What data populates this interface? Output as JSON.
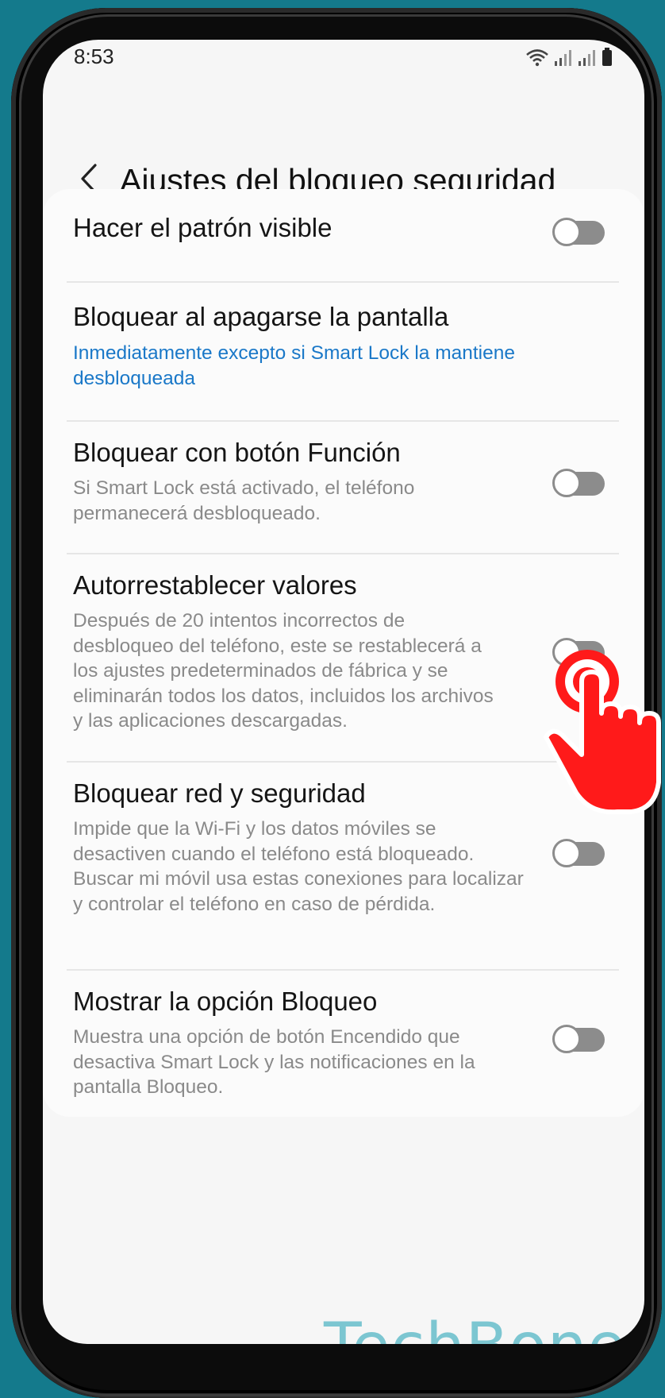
{
  "status": {
    "time": "8:53"
  },
  "header": {
    "title": "Ajustes del bloqueo seguridad"
  },
  "settings": [
    {
      "title": "Hacer el patrón visible",
      "subtitle": "",
      "toggle": "off"
    },
    {
      "title": "Bloquear al apagarse la pantalla",
      "subtitle": "Inmediatamente excepto si Smart Lock la mantiene desbloqueada"
    },
    {
      "title": "Bloquear con botón Función",
      "subtitle": "Si Smart Lock está activado, el teléfono permanecerá desbloqueado.",
      "toggle": "off"
    },
    {
      "title": "Autorrestablecer valores",
      "subtitle": "Después de 20 intentos incorrectos de desbloqueo del teléfono, este se restablecerá a los ajustes predeterminados de fábrica y se eliminarán todos los datos, incluidos los archivos y las aplicaciones descargadas.",
      "toggle": "off"
    },
    {
      "title": "Bloquear red y seguridad",
      "subtitle": "Impide que la Wi-Fi y los datos móviles se desactiven cuando el teléfono está bloqueado. Buscar mi móvil usa estas conexiones para localizar y controlar el teléfono en caso de pérdida.",
      "toggle": "off"
    },
    {
      "title": "Mostrar la opción Bloqueo",
      "subtitle": "Muestra una opción de botón Encendido que desactiva Smart Lock y las notificaciones en la pantalla Bloqueo.",
      "toggle": "off"
    }
  ],
  "watermark": "TechBone",
  "colors": {
    "background": "#147a8c",
    "link": "#1a78c8",
    "tap_indicator": "#ff1a1a",
    "watermark": "#7cc6d1"
  }
}
